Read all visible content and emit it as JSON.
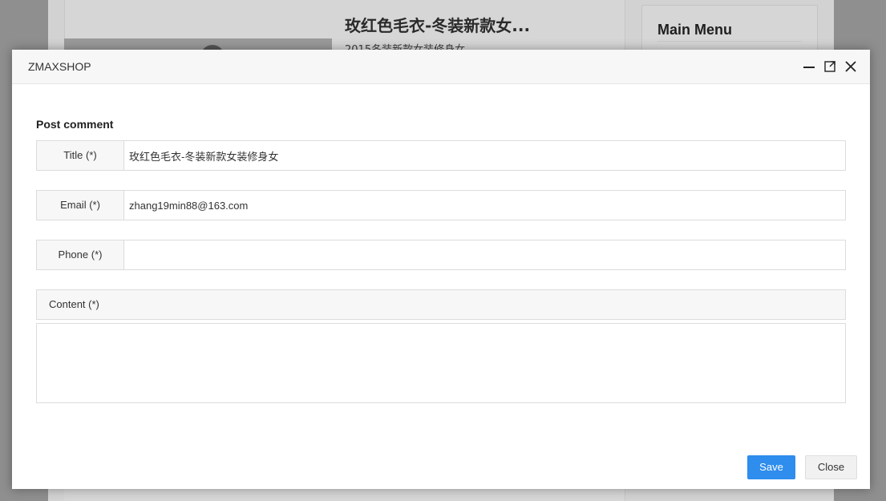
{
  "background": {
    "product_title": "玫红色毛衣-冬装新款女...",
    "product_subtitle": "2015冬装新款女装修身女",
    "sidebar_title": "Main Menu"
  },
  "modal": {
    "title": "ZMAXSHOP",
    "header_icons": [
      "minimize-icon",
      "maximize-icon",
      "close-icon"
    ],
    "section_title": "Post comment",
    "fields": {
      "title": {
        "label": "Title (*)",
        "value": "玫红色毛衣-冬装新款女装修身女"
      },
      "email": {
        "label": "Email (*)",
        "value": "zhang19min88@163.com"
      },
      "phone": {
        "label": "Phone (*)",
        "value": ""
      },
      "content": {
        "label": "Content (*)",
        "value": ""
      }
    },
    "buttons": {
      "save": "Save",
      "close": "Close"
    }
  },
  "colors": {
    "primary": "#2e8ded",
    "overlay": "#8f8f8f"
  }
}
